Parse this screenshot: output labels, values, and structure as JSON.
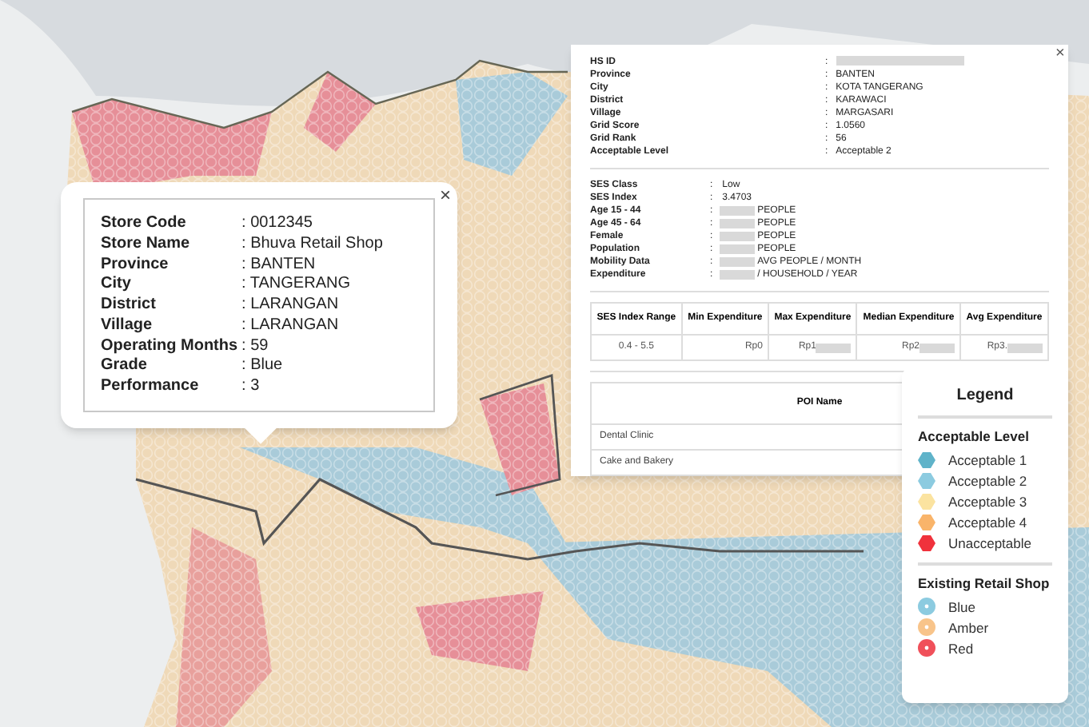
{
  "store_popup": {
    "close": "×",
    "separator": ":",
    "fields": [
      {
        "label": "Store Code",
        "value": "0012345"
      },
      {
        "label": "Store Name",
        "value": "Bhuva Retail Shop"
      },
      {
        "label": "Province",
        "value": "BANTEN"
      },
      {
        "label": "City",
        "value": "TANGERANG"
      },
      {
        "label": "District",
        "value": "LARANGAN"
      },
      {
        "label": "Village",
        "value": "LARANGAN"
      },
      {
        "label": "Operating Months",
        "value": "59"
      },
      {
        "label": "Grade",
        "value": "Blue"
      },
      {
        "label": "Performance",
        "value": "3"
      }
    ]
  },
  "grid_popup": {
    "close": "×",
    "separator": ":",
    "fields": [
      {
        "label": "HS ID",
        "redacted": true
      },
      {
        "label": "Province",
        "value": "BANTEN",
        "redacted": false
      },
      {
        "label": "City",
        "value": "KOTA TANGERANG",
        "redacted": false
      },
      {
        "label": "District",
        "value": "KARAWACI",
        "redacted": false
      },
      {
        "label": "Village",
        "value": "MARGASARI",
        "redacted": false
      },
      {
        "label": "Grid Score",
        "value": "1.0560",
        "redacted": false
      },
      {
        "label": "Grid Rank",
        "value": "56",
        "redacted": false
      },
      {
        "label": "Acceptable Level",
        "value": "Acceptable 2",
        "redacted": false
      }
    ],
    "ses_fields": [
      {
        "label": "SES Class",
        "value": "Low",
        "redacted": false
      },
      {
        "label": "SES Index",
        "value": "3.4703",
        "redacted": false
      },
      {
        "label": "Age 15 - 44",
        "value": "PEOPLE",
        "redacted": true
      },
      {
        "label": "Age 45 - 64",
        "value": "PEOPLE",
        "redacted": true
      },
      {
        "label": "Female",
        "value": "PEOPLE",
        "redacted": true
      },
      {
        "label": "Population",
        "value": "PEOPLE",
        "redacted": true
      },
      {
        "label": "Mobility Data",
        "value": "AVG PEOPLE / MONTH",
        "redacted": true
      },
      {
        "label": "Expenditure",
        "value": "/ HOUSEHOLD / YEAR",
        "redacted": true
      }
    ],
    "expenditure_table": {
      "columns": [
        "SES Index Range",
        "Min Expenditure",
        "Max Expenditure",
        "Median Expenditure",
        "Avg Expenditure"
      ],
      "rows": [
        [
          {
            "text": "0.4 - 5.5",
            "redacted": false
          },
          {
            "text": "Rp0",
            "redacted": false
          },
          {
            "text": "Rp1",
            "redacted": true
          },
          {
            "text": "Rp2",
            "redacted": true
          },
          {
            "text": "Rp3.",
            "redacted": true
          }
        ]
      ]
    },
    "poi_table": {
      "columns": [
        "POI Name"
      ],
      "rows": [
        "Dental Clinic",
        "Cake and Bakery"
      ]
    }
  },
  "legend": {
    "title": "Legend",
    "sections": [
      {
        "title": "Acceptable Level",
        "items": [
          {
            "label": "Acceptable 1",
            "color": "#5fb3c9",
            "kind": "hex"
          },
          {
            "label": "Acceptable 2",
            "color": "#8ccbe0",
            "kind": "hex"
          },
          {
            "label": "Acceptable 3",
            "color": "#fbe3a0",
            "kind": "hex"
          },
          {
            "label": "Acceptable 4",
            "color": "#f9b46a",
            "kind": "hex"
          },
          {
            "label": "Unacceptable",
            "color": "#f0323c",
            "kind": "hex"
          }
        ]
      },
      {
        "title": "Existing Retail Shop",
        "items": [
          {
            "label": "Blue",
            "color": "#8ccbe0",
            "kind": "dot"
          },
          {
            "label": "Amber",
            "color": "#f8c48a",
            "kind": "dot"
          },
          {
            "label": "Red",
            "color": "#f0505a",
            "kind": "dot"
          }
        ]
      }
    ]
  }
}
